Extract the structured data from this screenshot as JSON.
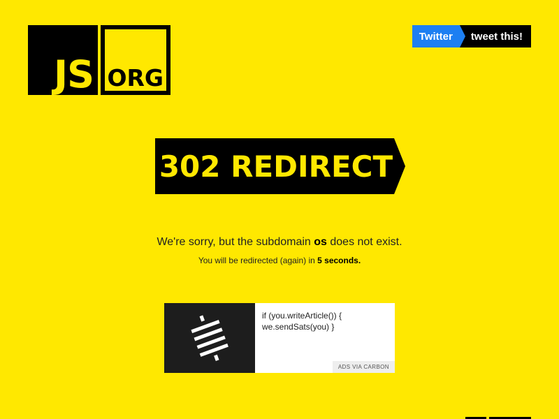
{
  "logo": {
    "js_text": "JS",
    "org_text": "ORG"
  },
  "tweet": {
    "twitter_label": "Twitter",
    "tweet_label": "tweet this!"
  },
  "banner": {
    "title": "302 REDIRECT"
  },
  "message": {
    "line1_prefix": "We're sorry, but the subdomain ",
    "subdomain": "os",
    "line1_suffix": " does not exist.",
    "line2_prefix": "You will be redirected (again) in ",
    "countdown": "5 seconds.",
    "line2_suffix": ""
  },
  "ad": {
    "text": "if (you.writeArticle()) { we.sendSats(you) }",
    "via_label": "ADS VIA CARBON",
    "icon": "lightning-stripes-icon"
  },
  "colors": {
    "background": "#ffe800",
    "black": "#000000",
    "twitter_blue": "#1d7ff2"
  }
}
